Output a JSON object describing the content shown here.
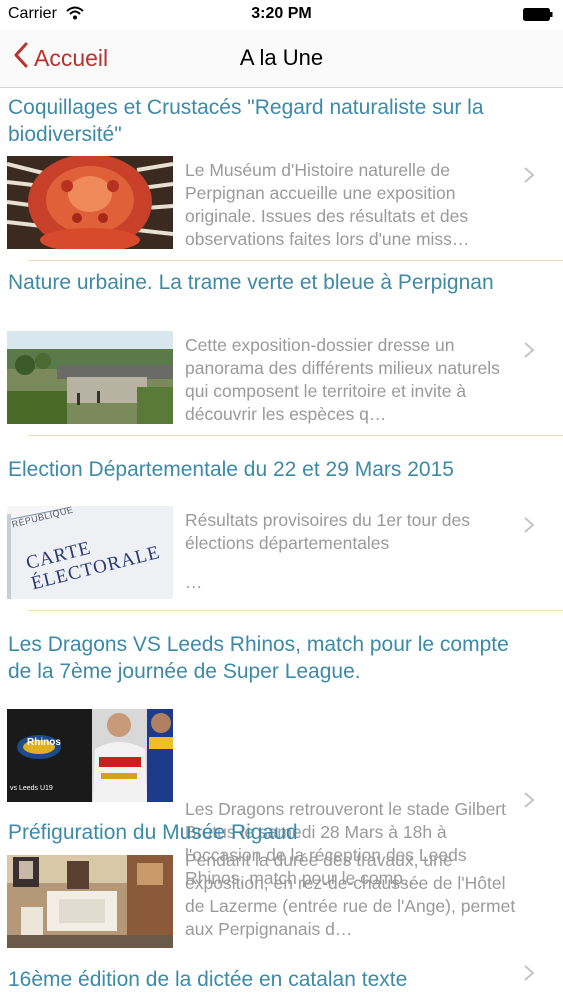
{
  "status": {
    "carrier": "Carrier",
    "time": "3:20 PM"
  },
  "nav": {
    "back_label": "Accueil",
    "title": "A la Une"
  },
  "articles": [
    {
      "title": "Coquillages et Crustacés \"Regard naturaliste sur la biodiversité\"",
      "summary": "Le Muséum d'Histoire naturelle de Perpignan accueille une exposition originale. Issues des résultats et des observations faites lors d'une miss…"
    },
    {
      "title": "Nature urbaine. La trame verte et bleue à Perpignan",
      "summary": "Cette exposition-dossier dresse un panorama des différents milieux naturels qui composent le territoire et invite à découvrir les espèces q…"
    },
    {
      "title": "Election Départementale du 22 et 29 Mars 2015",
      "summary": "Résultats provisoires du 1er tour des élections départementales",
      "summary_ellipsis": "…",
      "thumb_text": "CARTE ÉLECTORALE",
      "thumb_header": "RÉPUBLIQUE"
    },
    {
      "title": "Les Dragons VS  Leeds Rhinos, match pour le compte de la 7ème journée de Super League.",
      "summary": "Les Dragons retrouveront le stade Gilbert Brutus le samedi 28 Mars à 18h à l'occasion de la réception des Leeds Rhinos, match pour le comp…",
      "thumb_text_1": "Rhinos",
      "thumb_text_2": "vs Leeds U19"
    },
    {
      "title": "Préfiguration du Musée Rigaud",
      "summary": "Pendant la durée des travaux, une exposition, en rez-de-chaussée de l'Hôtel de Lazerme (entrée rue de l'Ange), permet aux Perpignanais d…"
    },
    {
      "title": "16ème édition de la dictée en catalan texte",
      "summary": ""
    }
  ],
  "colors": {
    "accent": "#b8322f",
    "title": "#3c8aa8",
    "summary": "#9a9a9a",
    "divider": "#ecdcbc"
  }
}
